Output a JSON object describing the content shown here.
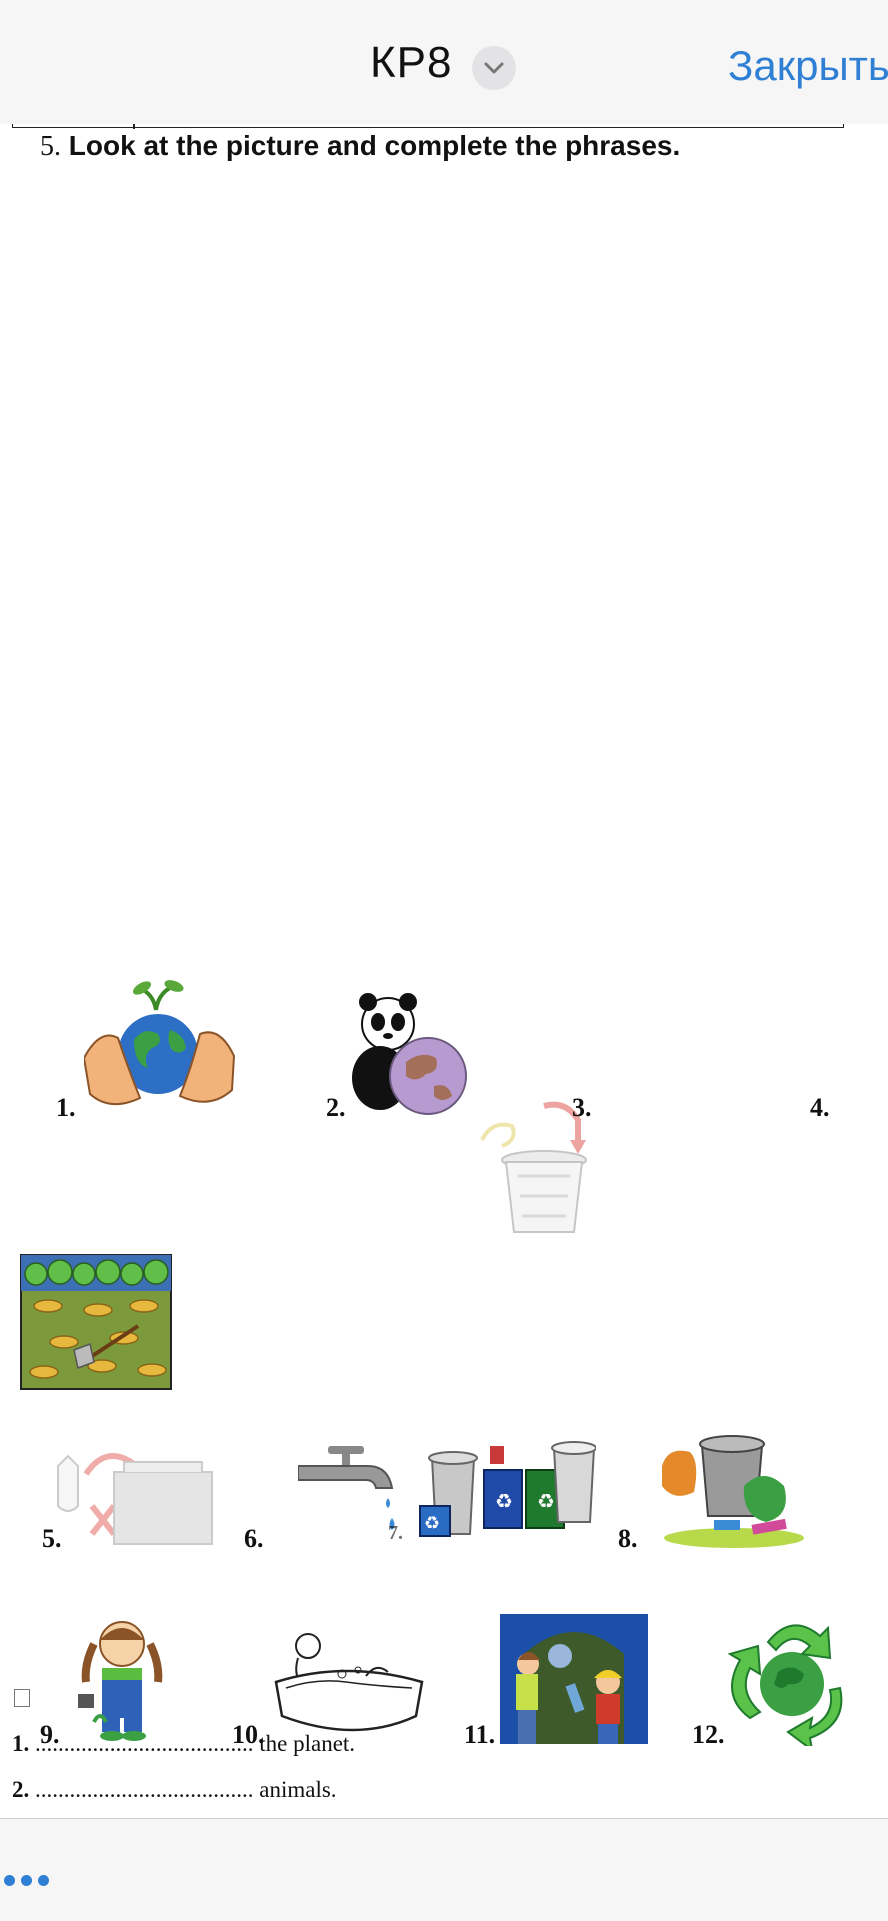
{
  "navbar": {
    "title": "КР8",
    "close_label": "Закрыть"
  },
  "task": {
    "number": "5.",
    "instruction": "Look at the picture and complete the phrases."
  },
  "pictures": [
    {
      "label": "1.",
      "icon": "hands-holding-earth-icon"
    },
    {
      "label": "2.",
      "icon": "panda-globe-icon"
    },
    {
      "label": "3.",
      "icon": "recycling-bin-icon"
    },
    {
      "label": "4.",
      "icon": "deforestation-icon"
    },
    {
      "label": "5.",
      "icon": "plastic-bag-bin-icon"
    },
    {
      "label": "6.",
      "icon": "dripping-tap-icon"
    },
    {
      "label": "7.",
      "icon": "recycling-bins-icon"
    },
    {
      "label": "8.",
      "icon": "garbage-can-icon"
    },
    {
      "label": "9.",
      "icon": "girl-gardener-icon"
    },
    {
      "label": "10.",
      "icon": "person-in-bath-icon"
    },
    {
      "label": "11.",
      "icon": "kids-recycling-bottles-icon"
    },
    {
      "label": "12.",
      "icon": "recycle-globe-icon"
    }
  ],
  "phrases": [
    {
      "number": "1.",
      "blank": "......................................",
      "text": "the planet."
    },
    {
      "number": "2.",
      "blank": "......................................",
      "text": "animals."
    }
  ],
  "colors": {
    "accent": "#2f7fd4",
    "toolbar_bg": "#f6f6f6"
  }
}
